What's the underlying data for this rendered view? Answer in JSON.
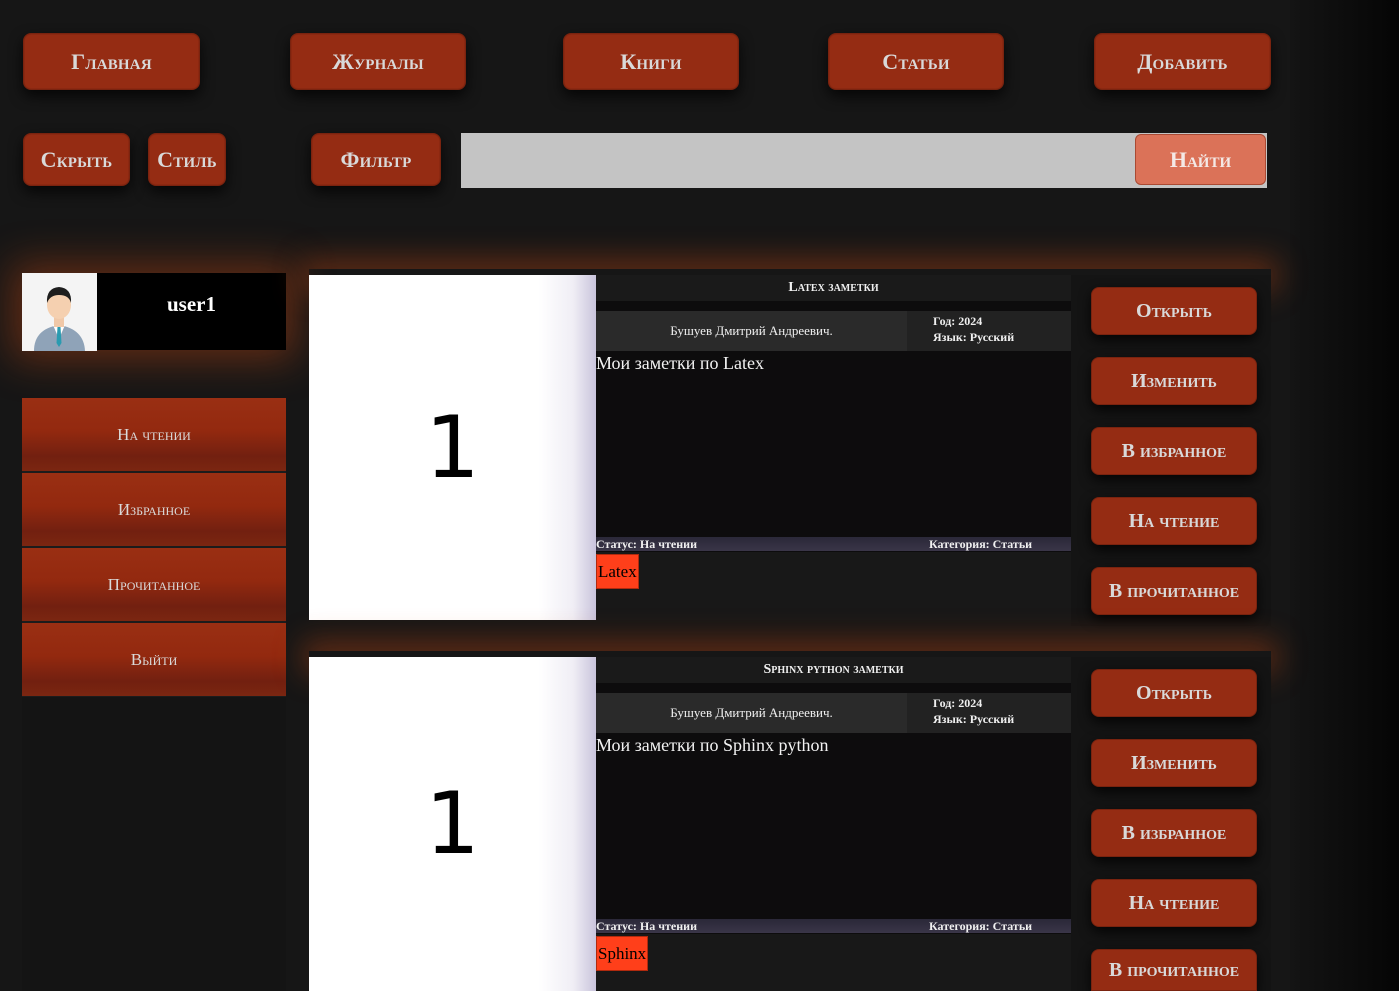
{
  "nav": {
    "home": "Главная",
    "journals": "Журналы",
    "books": "Книги",
    "articles": "Статьи",
    "add": "Добавить"
  },
  "toolbar": {
    "hide": "Скрыть",
    "style": "Стиль",
    "filter": "Фильтр",
    "search_value": "",
    "find": "Найти"
  },
  "user": {
    "name": "user1",
    "avatar_icon": "user-avatar-icon"
  },
  "sidebar": {
    "items": [
      {
        "label": "На чтении"
      },
      {
        "label": "Избранное"
      },
      {
        "label": "Прочитанное"
      },
      {
        "label": "Выйти"
      }
    ]
  },
  "cards": [
    {
      "cover_text": "1",
      "title": "Latex заметки",
      "author": "Бушуев Дмитрий Андреевич.",
      "year": "Год: 2024",
      "language": "Язык: Русский",
      "description": "Мои заметки по Latex",
      "status": "Статус: На чтении",
      "category": "Категория: Статьи",
      "tag": "Latex",
      "actions": [
        "Открыть",
        "Изменить",
        "В избранное",
        "На чтение",
        "В прочитанное"
      ]
    },
    {
      "cover_text": "1",
      "title": "Sphinx python заметки",
      "author": "Бушуев Дмитрий Андреевич.",
      "year": "Год: 2024",
      "language": "Язык: Русский",
      "description": "Мои заметки по Sphinx python",
      "status": "Статус: На чтении",
      "category": "Категория: Статьи",
      "tag": "Sphinx",
      "actions": [
        "Открыть",
        "Изменить",
        "В избранное",
        "На чтение",
        "В прочитанное"
      ]
    }
  ],
  "colors": {
    "accent": "#952c13",
    "find_button": "#db7258",
    "tag": "#ff3f1a"
  }
}
